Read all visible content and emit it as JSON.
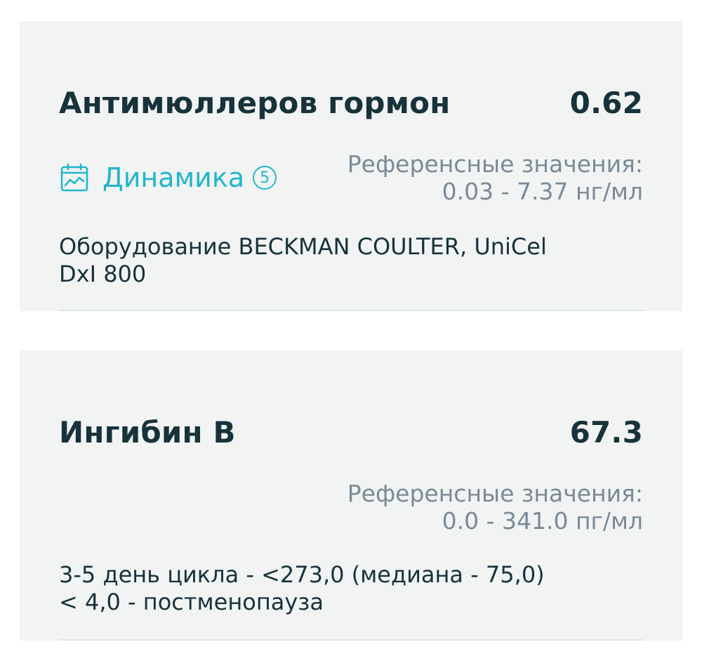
{
  "tests": [
    {
      "name": "Антимюллеров гормон",
      "value": "0.62",
      "dynamics": {
        "label": "Динамика",
        "count": "5"
      },
      "ref_label": "Референсные значения:",
      "ref_range": "0.03 - 7.37 нг/мл",
      "note_lines": [
        "Оборудование BECKMAN COULTER, UniCel",
        "DxI 800"
      ]
    },
    {
      "name": "Ингибин В",
      "value": "67.3",
      "ref_label": "Референсные значения:",
      "ref_range": "0.0 - 341.0 пг/мл",
      "note_lines": [
        "3-5 день цикла - <273,0 (медиана - 75,0)",
        "< 4,0 - постменопауза"
      ]
    }
  ],
  "colors": {
    "accent": "#22b6cc",
    "title": "#17323a",
    "muted": "#7a8a96",
    "card_bg": "#f2f4f4"
  },
  "icons": {
    "dynamics": "calendar-chart-icon"
  }
}
